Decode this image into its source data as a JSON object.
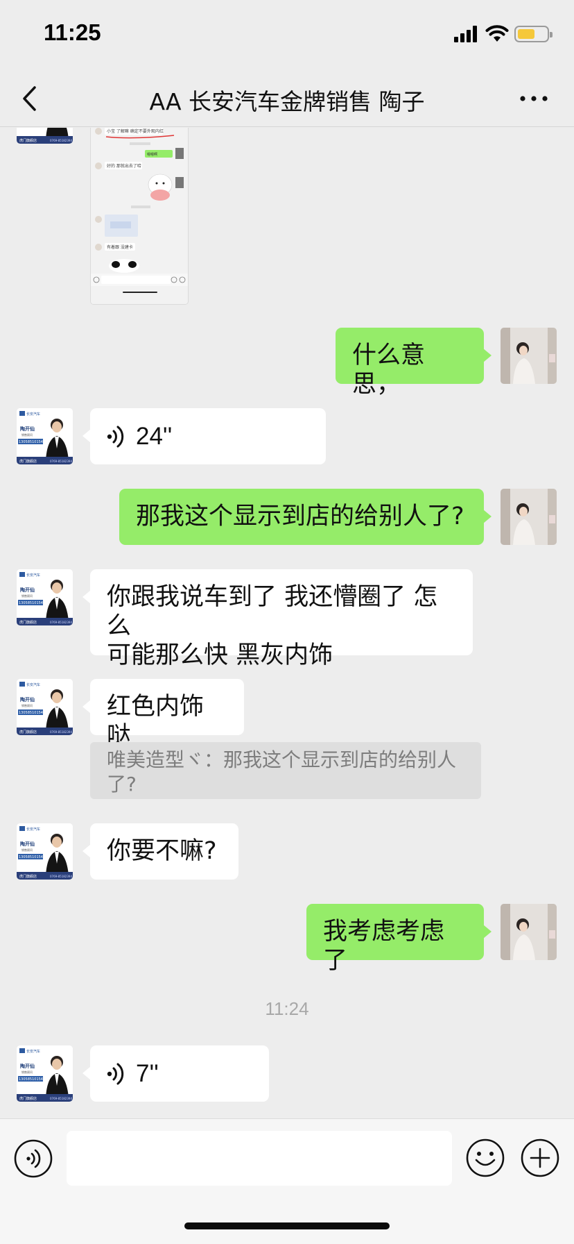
{
  "status_bar": {
    "time": "11:25",
    "battery_color": "#f5c83a"
  },
  "nav": {
    "title": "AA 长安汽车金牌销售 陶子",
    "back_icon": "chevron-left-icon",
    "more_icon": "ellipsis-icon"
  },
  "salesman_card": {
    "brand": "长安汽车",
    "name": "陶开仙",
    "role": "销售顾问",
    "phone": "13058510154",
    "footer": "虎门旗舰店"
  },
  "thumbnail": {
    "line_1": "小宝 了解嘛 确定不要外观内红",
    "bubble_1": "嗯嗯啊",
    "line_2": "好的 那就出去了哈",
    "line_3": "有着跟 没建卡"
  },
  "messages": [
    {
      "side": "out",
      "type": "text",
      "text": "什么意思，"
    },
    {
      "side": "in",
      "type": "voice",
      "duration": "24''"
    },
    {
      "side": "out",
      "type": "text",
      "text": "那我这个显示到店的给别人了?"
    },
    {
      "side": "in",
      "type": "text",
      "lines": [
        "你跟我说车到了 我还懵圈了 怎么",
        "可能那么快 黑灰内饰"
      ]
    },
    {
      "side": "in",
      "type": "text",
      "text": "红色内饰哒",
      "quote": {
        "lines": [
          "唯美造型ヾ：那我这个显示到店的给别人",
          "了?"
        ]
      }
    },
    {
      "side": "in",
      "type": "text",
      "text": "你要不嘛?"
    },
    {
      "side": "out",
      "type": "text",
      "text": "我考虑考虑了"
    },
    {
      "side": "divider",
      "type": "time",
      "text": "11:24"
    },
    {
      "side": "in",
      "type": "voice",
      "duration": "7''"
    }
  ],
  "input_bar": {
    "placeholder": "",
    "voice_icon": "voice-input-icon",
    "emoji_icon": "emoji-icon",
    "plus_icon": "plus-circle-icon"
  },
  "colors": {
    "background": "#ededed",
    "outgoing_bubble": "#95ec69",
    "incoming_bubble": "#ffffff"
  }
}
